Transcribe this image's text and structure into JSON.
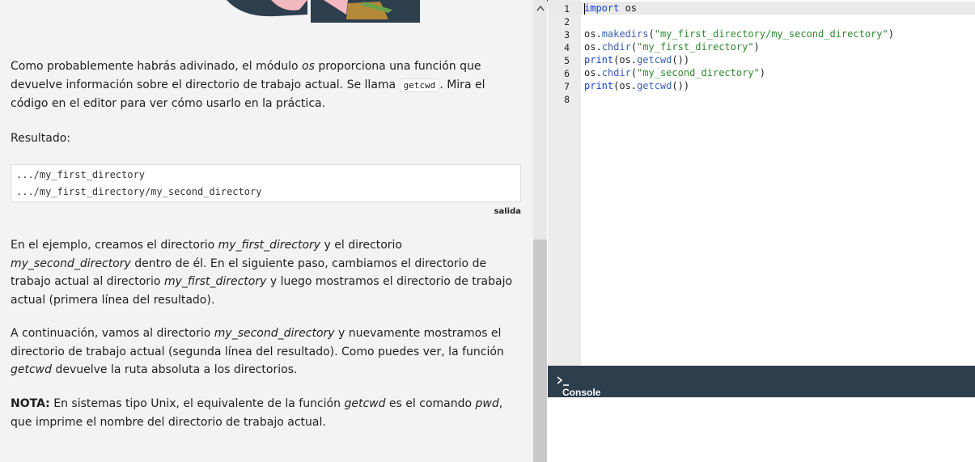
{
  "lesson": {
    "para1": {
      "t1": "Como probablemente habrás adivinado, el módulo ",
      "em1": "os",
      "t2": " proporciona una función que devuelve información sobre el directorio de trabajo actual. Se llama ",
      "code1": "getcwd",
      "t3": ". Mira el código en el editor para ver cómo usarlo en la práctica."
    },
    "result_label": "Resultado:",
    "output_lines": [
      ".../my_first_directory",
      ".../my_first_directory/my_second_directory"
    ],
    "output_caption": "salida",
    "para2": {
      "t1": "En el ejemplo, creamos el directorio ",
      "em1": "my_first_directory",
      "t2": " y el directorio ",
      "em2": "my_second_directory",
      "t3": " dentro de él. En el siguiente paso, cambiamos el directorio de trabajo actual al directorio ",
      "em3": "my_first_directory",
      "t4": " y luego mostramos el directorio de trabajo actual (primera línea del resultado)."
    },
    "para3": {
      "t1": "A continuación, vamos al directorio ",
      "em1": "my_second_directory",
      "t2": " y nuevamente mostramos el directorio de trabajo actual (segunda línea del resultado). Como puedes ver, la función ",
      "em2": "getcwd",
      "t3": " devuelve la ruta absoluta a los directorios."
    },
    "para4": {
      "bold": "NOTA:",
      "t1": " En sistemas tipo Unix, el equivalente de la función ",
      "em1": "getcwd",
      "t2": " es el comando ",
      "em2": "pwd",
      "t3": ", que imprime el nombre del directorio de trabajo actual."
    }
  },
  "editor": {
    "line_numbers": [
      "1",
      "2",
      "3",
      "4",
      "5",
      "6",
      "7",
      "8"
    ],
    "l1": {
      "kw": "import",
      "rest": " os"
    },
    "l3": {
      "a": "os.",
      "f": "makedirs",
      "b": "(",
      "s": "\"my_first_directory/my_second_directory\"",
      "c": ")"
    },
    "l4": {
      "a": "os.",
      "f": "chdir",
      "b": "(",
      "s": "\"my_first_directory\"",
      "c": ")"
    },
    "l5": {
      "kw": "print",
      "a": "(os.",
      "f": "getcwd",
      "c": "())"
    },
    "l6": {
      "a": "os.",
      "f": "chdir",
      "b": "(",
      "s": "\"my_second_directory\"",
      "c": ")"
    },
    "l7": {
      "kw": "print",
      "a": "(os.",
      "f": "getcwd",
      "c": "())"
    }
  },
  "console": {
    "label": "Console",
    "prompt_icon": "terminal-prompt-icon"
  },
  "scroll_up_icon": "chevron-up-icon",
  "colors": {
    "console_bar": "#2d3e4d",
    "keyword": "#1a3fd1",
    "string": "#2f8a2f"
  }
}
